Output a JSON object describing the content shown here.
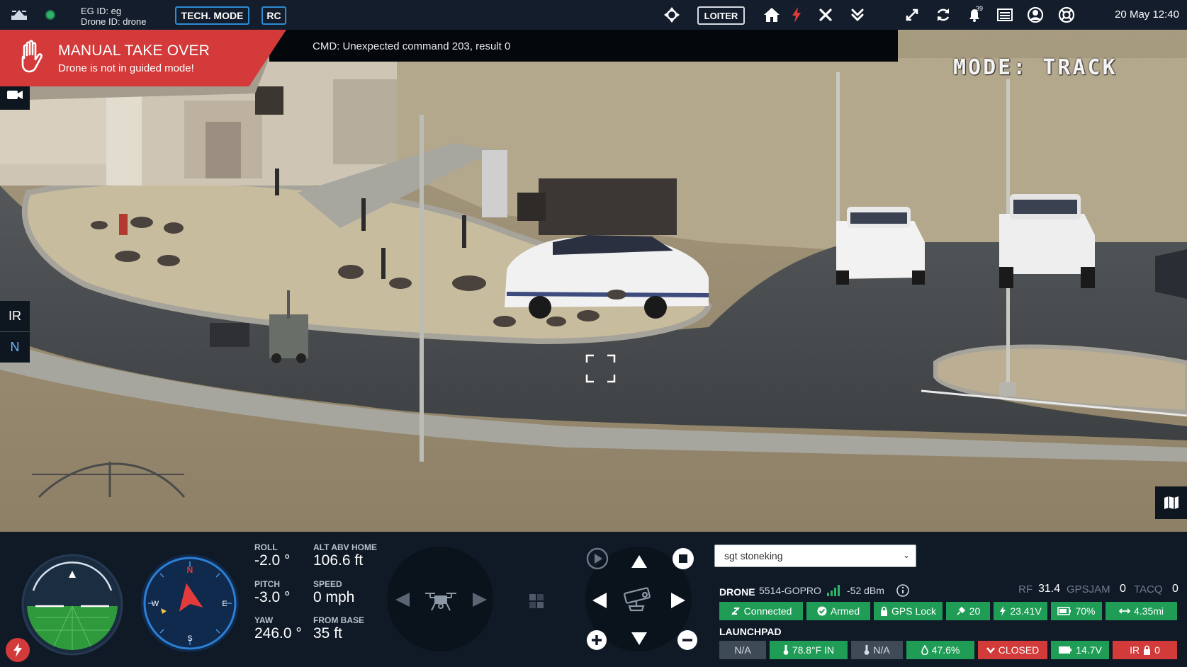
{
  "topbar": {
    "eg_id": "EG ID: eg",
    "drone_id": "Drone ID: drone",
    "tech_mode": "TECH. MODE",
    "rc": "RC",
    "loiter": "LOITER",
    "notification_count": "39",
    "datetime": "20 May 12:40"
  },
  "alert": {
    "title": "MANUAL TAKE OVER",
    "subtitle": "Drone is not in guided mode!"
  },
  "cmd": "CMD: Unexpected command 203, result 0",
  "overlay": {
    "mode": "MODE: TRACK",
    "ir": "IR",
    "n": "N"
  },
  "telemetry": {
    "roll_label": "ROLL",
    "roll": "-2.0 °",
    "pitch_label": "PITCH",
    "pitch": "-3.0 °",
    "yaw_label": "YAW",
    "yaw": "246.0 °",
    "alt_label": "ALT ABV HOME",
    "alt": "106.6 ft",
    "speed_label": "SPEED",
    "speed": "0 mph",
    "base_label": "FROM BASE",
    "base": "35 ft"
  },
  "compass": {
    "n": "N",
    "e": "E",
    "s": "S",
    "w": "W"
  },
  "select": {
    "value": "sgt stoneking"
  },
  "drone": {
    "label": "DRONE",
    "model": "5514-GOPRO",
    "signal": "-52 dBm",
    "rf_label": "RF",
    "rf": "31.4",
    "gpsjam_label": "GPSJAM",
    "gpsjam": "0",
    "tacq_label": "TACQ",
    "tacq": "0",
    "badges": {
      "connected": "Connected",
      "armed": "Armed",
      "gps": "GPS Lock",
      "sats": "20",
      "voltage": "23.41V",
      "battery": "70%",
      "distance": "4.35mi"
    }
  },
  "launchpad": {
    "label": "LAUNCHPAD",
    "na1": "N/A",
    "temp": "78.8°F IN",
    "na2": "N/A",
    "humidity": "47.6%",
    "state": "CLOSED",
    "voltage": "14.7V",
    "ir": "IR",
    "ir_val": "0"
  },
  "colors": {
    "accent": "#2d8cd6",
    "alert": "#d43a3a",
    "ok": "#1f9d57",
    "panel": "#101a27"
  }
}
